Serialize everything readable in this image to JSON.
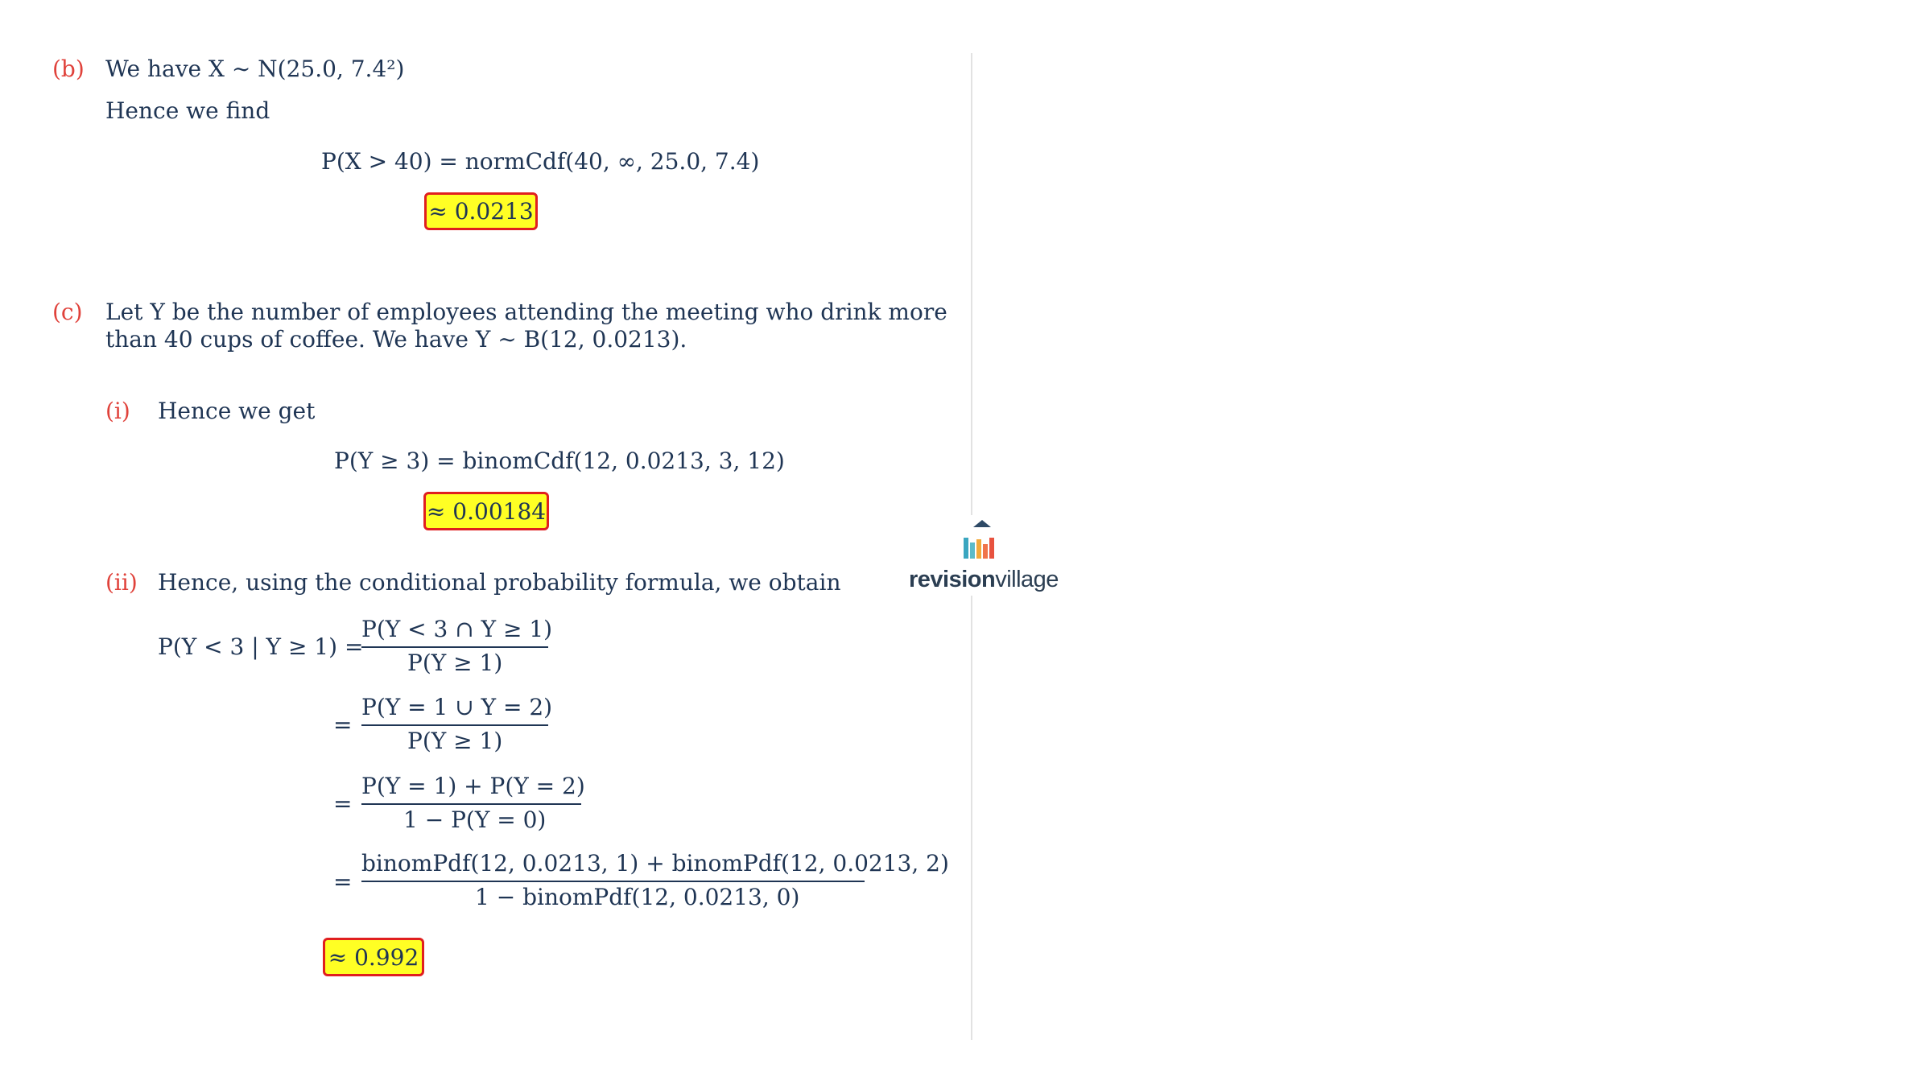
{
  "part_b": {
    "marker": "(b)",
    "line1": "We have X ∼ N(25.0, 7.4²)",
    "line2": "Hence we find",
    "equation": "P(X > 40) = normCdf(40, ∞, 25.0, 7.4)",
    "answer": "≈ 0.0213"
  },
  "part_c": {
    "marker": "(c)",
    "line1": "Let Y be the number of employees attending the meeting who drink more",
    "line2": "than 40 cups of coffee. We have Y ∼ B(12, 0.0213).",
    "sub_i": {
      "marker": "(i)",
      "text": "Hence we get",
      "equation": "P(Y ≥ 3) = binomCdf(12, 0.0213, 3, 12)",
      "answer": "≈ 0.00184"
    },
    "sub_ii": {
      "marker": "(ii)",
      "text": "Hence, using the conditional probability formula, we obtain",
      "lhs": "P(Y < 3 | Y ≥ 1) =",
      "equals": "=",
      "frac1_num": "P(Y < 3 ∩ Y ≥ 1)",
      "frac1_den": "P(Y ≥ 1)",
      "frac2_num": "P(Y = 1 ∪ Y = 2)",
      "frac2_den": "P(Y ≥ 1)",
      "frac3_num": "P(Y = 1) + P(Y = 2)",
      "frac3_den": "1 − P(Y = 0)",
      "frac4_num": "binomPdf(12, 0.0213, 1) + binomPdf(12, 0.0213, 2)",
      "frac4_den": "1 − binomPdf(12, 0.0213, 0)",
      "answer": "≈ 0.992"
    }
  },
  "logo": {
    "word_bold": "revision",
    "word_light": "village",
    "colors": [
      "#3aa6c0",
      "#f2a93b",
      "#8ec24a",
      "#e8523f",
      "#2e6b87"
    ]
  }
}
